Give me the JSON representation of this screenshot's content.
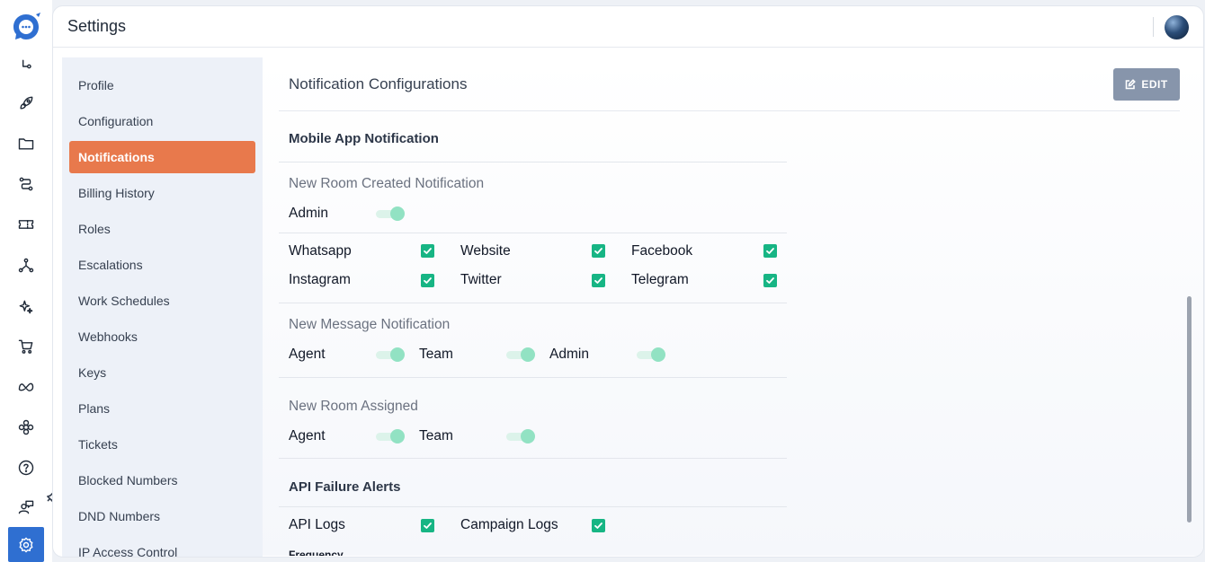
{
  "app": {
    "title": "Settings"
  },
  "rail": {
    "icons": [
      "chat-logo-icon",
      "flow-icon",
      "rocket-icon",
      "folder-icon",
      "workflow-icon",
      "ticket-icon",
      "network-icon",
      "sparkle-icon",
      "cart-icon",
      "meta-icon",
      "ai-icon",
      "help-icon",
      "support-agent-icon",
      "settings-icon"
    ]
  },
  "settings_nav": {
    "items": [
      {
        "label": "Profile",
        "active": false
      },
      {
        "label": "Configuration",
        "active": false
      },
      {
        "label": "Notifications",
        "active": true
      },
      {
        "label": "Billing History",
        "active": false
      },
      {
        "label": "Roles",
        "active": false
      },
      {
        "label": "Escalations",
        "active": false
      },
      {
        "label": "Work Schedules",
        "active": false
      },
      {
        "label": "Webhooks",
        "active": false
      },
      {
        "label": "Keys",
        "active": false
      },
      {
        "label": "Plans",
        "active": false
      },
      {
        "label": "Tickets",
        "active": false
      },
      {
        "label": "Blocked Numbers",
        "active": false
      },
      {
        "label": "DND Numbers",
        "active": false
      },
      {
        "label": "IP Access Control",
        "active": false
      }
    ]
  },
  "content": {
    "title": "Notification Configurations",
    "edit_label": "EDIT",
    "mobile_section": "Mobile App Notification",
    "new_room_created": {
      "title": "New Room Created Notification",
      "admin_label": "Admin",
      "admin_on": true,
      "channels": [
        {
          "label": "Whatsapp",
          "checked": true
        },
        {
          "label": "Website",
          "checked": true
        },
        {
          "label": "Facebook",
          "checked": true
        },
        {
          "label": "Instagram",
          "checked": true
        },
        {
          "label": "Twitter",
          "checked": true
        },
        {
          "label": "Telegram",
          "checked": true
        }
      ]
    },
    "new_message": {
      "title": "New Message Notification",
      "agent_label": "Agent",
      "team_label": "Team",
      "admin_label": "Admin"
    },
    "new_room_assigned": {
      "title": "New Room Assigned",
      "agent_label": "Agent",
      "team_label": "Team"
    },
    "api_section": "API Failure Alerts",
    "api": {
      "api_logs_label": "API Logs",
      "campaign_logs_label": "Campaign Logs",
      "frequency_label": "Frequency"
    }
  },
  "colors": {
    "accent": "#e8794c",
    "rail_active": "#2f6fd1",
    "check": "#17b584",
    "toggle_knob": "#92e2c3",
    "edit_button": "#8795ab"
  }
}
